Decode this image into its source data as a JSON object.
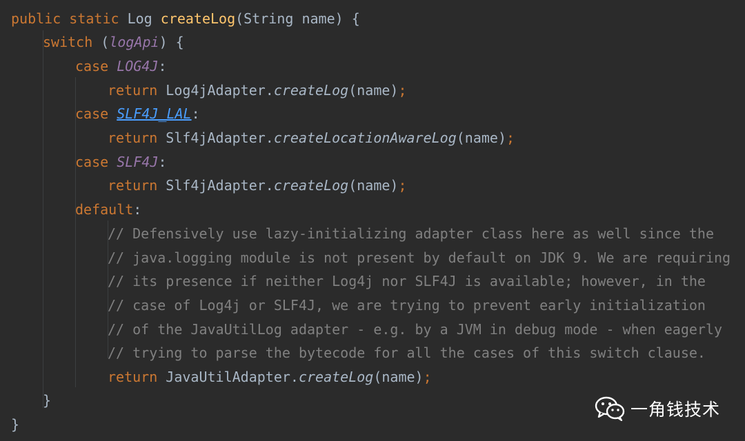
{
  "code": {
    "lines": [
      [
        {
          "t": "public ",
          "c": "kw"
        },
        {
          "t": "static ",
          "c": "kw"
        },
        {
          "t": "Log ",
          "c": "txt"
        },
        {
          "t": "createLog",
          "c": "fn"
        },
        {
          "t": "(String name) {",
          "c": "txt"
        }
      ],
      [
        {
          "t": "switch ",
          "c": "kw"
        },
        {
          "t": "(",
          "c": "txt"
        },
        {
          "t": "logApi",
          "c": "const"
        },
        {
          "t": ") {",
          "c": "txt"
        }
      ],
      [
        {
          "t": "case ",
          "c": "kw"
        },
        {
          "t": "LOG4J",
          "c": "const"
        },
        {
          "t": ":",
          "c": "txt"
        }
      ],
      [
        {
          "t": "return ",
          "c": "kw"
        },
        {
          "t": "Log4jAdapter.",
          "c": "txt"
        },
        {
          "t": "createLog",
          "c": "txt it"
        },
        {
          "t": "(name)",
          "c": "txt"
        },
        {
          "t": ";",
          "c": "kw"
        }
      ],
      [
        {
          "t": "case ",
          "c": "kw"
        },
        {
          "t": "SLF4J_LAL",
          "c": "link"
        },
        {
          "t": ":",
          "c": "txt"
        }
      ],
      [
        {
          "t": "return ",
          "c": "kw"
        },
        {
          "t": "Slf4jAdapter.",
          "c": "txt"
        },
        {
          "t": "createLocationAwareLog",
          "c": "txt it"
        },
        {
          "t": "(name)",
          "c": "txt"
        },
        {
          "t": ";",
          "c": "kw"
        }
      ],
      [
        {
          "t": "case ",
          "c": "kw"
        },
        {
          "t": "SLF4J",
          "c": "const"
        },
        {
          "t": ":",
          "c": "txt"
        }
      ],
      [
        {
          "t": "return ",
          "c": "kw"
        },
        {
          "t": "Slf4jAdapter.",
          "c": "txt"
        },
        {
          "t": "createLog",
          "c": "txt it"
        },
        {
          "t": "(name)",
          "c": "txt"
        },
        {
          "t": ";",
          "c": "kw"
        }
      ],
      [
        {
          "t": "default",
          "c": "kw"
        },
        {
          "t": ":",
          "c": "txt"
        }
      ],
      [
        {
          "t": "// Defensively use lazy-initializing adapter class here as well since the",
          "c": "cmt"
        }
      ],
      [
        {
          "t": "// java.logging module is not present by default on JDK 9. We are requiring",
          "c": "cmt"
        }
      ],
      [
        {
          "t": "// its presence if neither Log4j nor SLF4J is available; however, in the",
          "c": "cmt"
        }
      ],
      [
        {
          "t": "// case of Log4j or SLF4J, we are trying to prevent early initialization",
          "c": "cmt"
        }
      ],
      [
        {
          "t": "// of the JavaUtilLog adapter - e.g. by a JVM in debug mode - when eagerly",
          "c": "cmt"
        }
      ],
      [
        {
          "t": "// trying to parse the bytecode for all the cases of this switch clause.",
          "c": "cmt"
        }
      ],
      [
        {
          "t": "return ",
          "c": "kw"
        },
        {
          "t": "JavaUtilAdapter.",
          "c": "txt"
        },
        {
          "t": "createLog",
          "c": "txt it"
        },
        {
          "t": "(name)",
          "c": "txt"
        },
        {
          "t": ";",
          "c": "kw"
        }
      ],
      [
        {
          "t": "}",
          "c": "txt"
        }
      ],
      [
        {
          "t": "}",
          "c": "txt"
        }
      ]
    ]
  },
  "watermark": {
    "text": "一角钱技术",
    "icon": "wechat-icon"
  },
  "colors": {
    "background": "#2b2b2b",
    "keyword": "#cc7832",
    "function": "#ffc66d",
    "text": "#a9b7c6",
    "constant": "#9876aa",
    "comment": "#808080",
    "link": "#4a9eff"
  }
}
